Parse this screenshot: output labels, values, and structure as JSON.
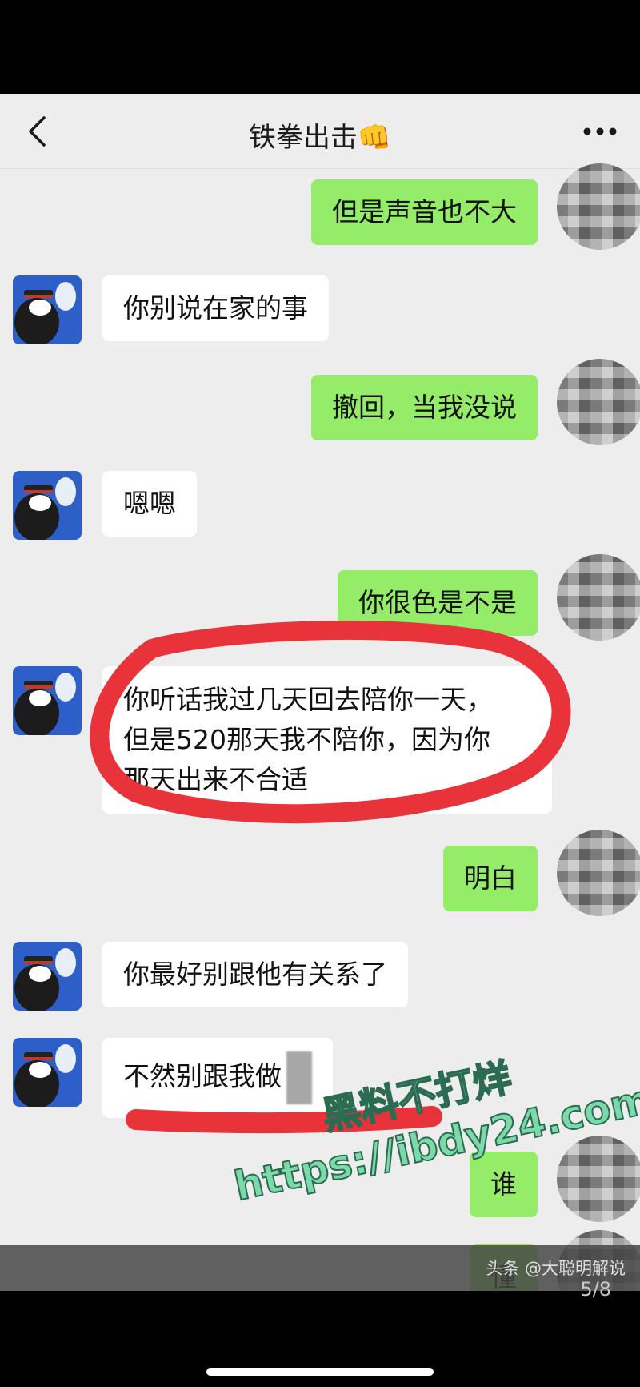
{
  "header": {
    "title": "铁拳出击👊"
  },
  "messages": [
    {
      "side": "out",
      "text": "但是声音也不大"
    },
    {
      "side": "in",
      "text": "你别说在家的事"
    },
    {
      "side": "out",
      "text": "撤回，当我没说"
    },
    {
      "side": "in",
      "text": "嗯嗯"
    },
    {
      "side": "out",
      "text": "你很色是不是"
    },
    {
      "side": "in",
      "lines": [
        "你听话我过几天回去陪你一天，",
        "但是520那天我不陪你，因为你",
        "那天出来不合适"
      ]
    },
    {
      "side": "out",
      "text": "明白"
    },
    {
      "side": "in",
      "text": "你最好别跟他有关系了"
    },
    {
      "side": "in",
      "text": "不然别跟我做"
    },
    {
      "side": "out",
      "text": "谁"
    },
    {
      "side": "out",
      "text": "懂"
    }
  ],
  "watermark": {
    "line1": "黑料不打烊",
    "line2": "https://ibdy24.com"
  },
  "footer": {
    "source": "头条 @大聪明解说",
    "page": "5/8"
  },
  "colors": {
    "self_bubble": "#95ec69",
    "other_bubble": "#ffffff",
    "annotation": "#e8333a"
  }
}
